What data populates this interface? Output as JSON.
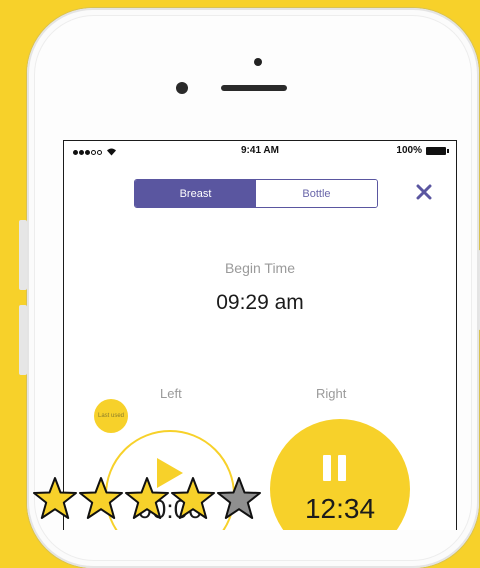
{
  "status_bar": {
    "time": "9:41 AM",
    "battery": "100%"
  },
  "segmented": {
    "breast": "Breast",
    "bottle": "Bottle"
  },
  "begin": {
    "label": "Begin Time",
    "time": "09:29 am"
  },
  "sides": {
    "left": "Left",
    "right": "Right"
  },
  "badge": {
    "last_used": "Last used"
  },
  "timers": {
    "left": "00:00",
    "right": "12:34"
  },
  "rating": {
    "value": 4,
    "max": 5
  },
  "colors": {
    "background": "#f7d12a",
    "accent_purple": "#5a56a0",
    "star_gold": "#f7d12a",
    "star_empty": "#8f8f8f"
  },
  "icons": [
    "close-icon",
    "play-icon",
    "pause-icon",
    "wifi-icon",
    "battery-icon",
    "star-icon"
  ]
}
